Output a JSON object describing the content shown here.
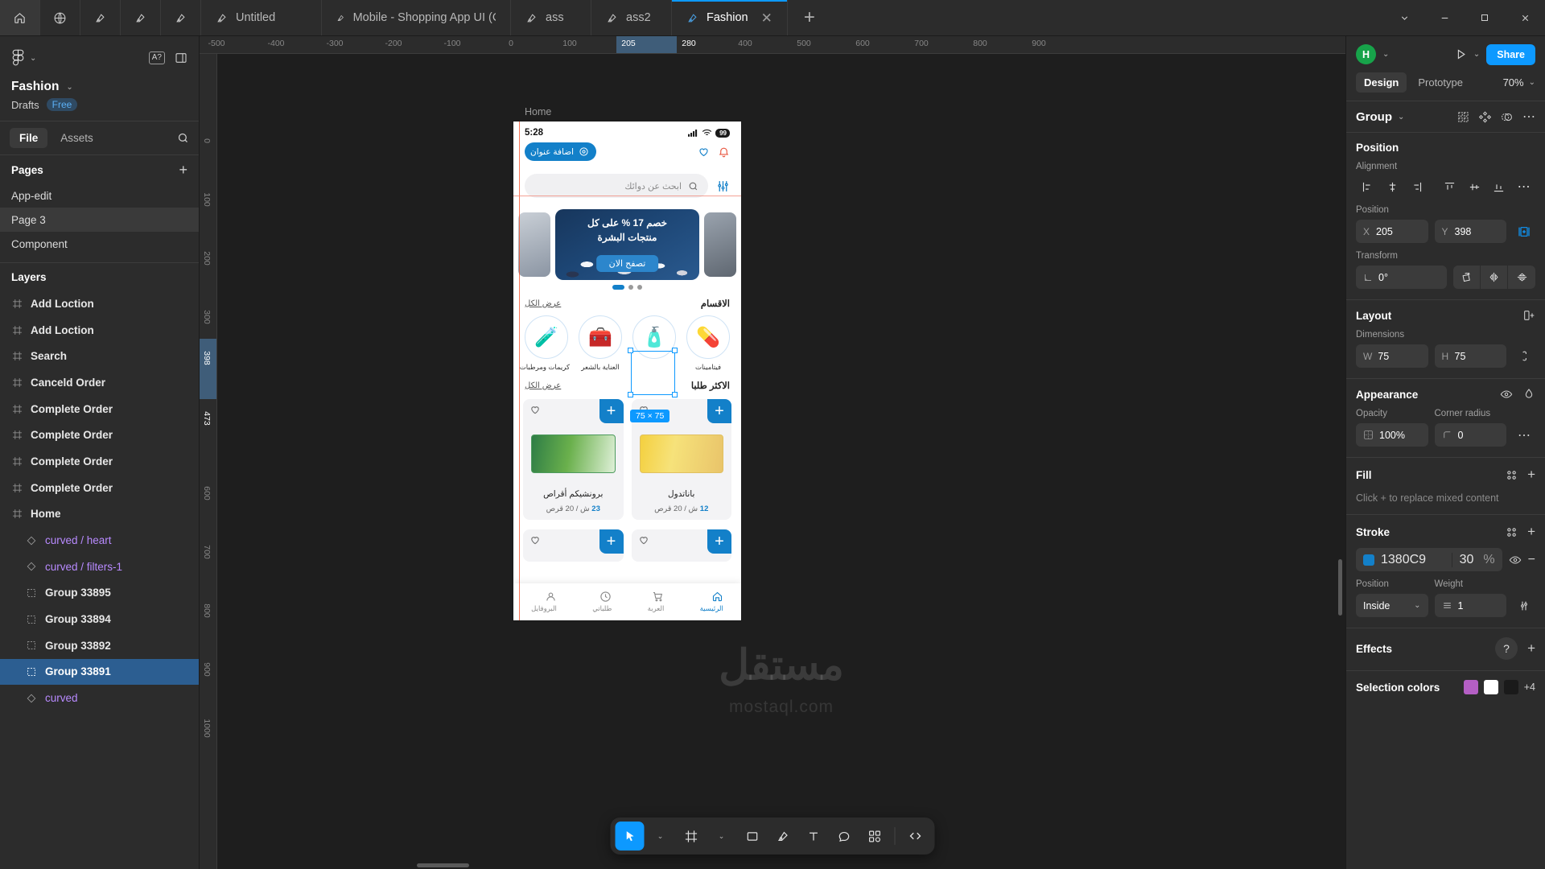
{
  "tabbar": {
    "left_icons": [
      "home-icon",
      "globe-icon",
      "file-icon",
      "file-icon",
      "file-icon"
    ],
    "tabs": [
      {
        "label": "Untitled",
        "icon": "figma-file-icon",
        "active": false,
        "closable": false
      },
      {
        "label": "Mobile - Shopping App UI (Community)",
        "icon": "figma-file-icon",
        "active": false,
        "closable": false
      },
      {
        "label": "ass",
        "icon": "figma-file-icon",
        "active": false,
        "closable": false
      },
      {
        "label": "ass2",
        "icon": "figma-file-icon",
        "active": false,
        "closable": false
      },
      {
        "label": "Fashion",
        "icon": "figma-file-icon",
        "active": true,
        "closable": true
      }
    ],
    "new_tab_label": "+",
    "window_controls": [
      "chevron-down-icon",
      "minimize-icon",
      "maximize-icon",
      "close-icon"
    ]
  },
  "left_panel": {
    "menu_icon": "figma-logo-icon",
    "a11y_badge": "A?",
    "panel_toggle_icon": "panel-layout-icon",
    "file_name": "Fashion",
    "location": "Drafts",
    "plan_badge": "Free",
    "tabs": [
      {
        "label": "File",
        "active": true
      },
      {
        "label": "Assets",
        "active": false
      }
    ],
    "search_icon": "search-icon",
    "pages_title": "Pages",
    "pages_add_label": "+",
    "pages": [
      {
        "label": "App-edit",
        "selected": false
      },
      {
        "label": "Page 3",
        "selected": true
      },
      {
        "label": "Component",
        "selected": false
      }
    ],
    "layers_title": "Layers",
    "layers": [
      {
        "label": "Add Loction",
        "icon": "frame-icon",
        "type": "frame",
        "depth": 0,
        "selected": false
      },
      {
        "label": "Add Loction",
        "icon": "frame-icon",
        "type": "frame",
        "depth": 0,
        "selected": false
      },
      {
        "label": "Search",
        "icon": "frame-icon",
        "type": "frame",
        "depth": 0,
        "selected": false
      },
      {
        "label": "Canceld Order",
        "icon": "frame-icon",
        "type": "frame",
        "depth": 0,
        "selected": false
      },
      {
        "label": "Complete Order",
        "icon": "frame-icon",
        "type": "frame",
        "depth": 0,
        "selected": false
      },
      {
        "label": "Complete Order",
        "icon": "frame-icon",
        "type": "frame",
        "depth": 0,
        "selected": false
      },
      {
        "label": "Complete Order",
        "icon": "frame-icon",
        "type": "frame",
        "depth": 0,
        "selected": false
      },
      {
        "label": "Complete Order",
        "icon": "frame-icon",
        "type": "frame",
        "depth": 0,
        "selected": false
      },
      {
        "label": "Home",
        "icon": "frame-icon",
        "type": "frame",
        "depth": 0,
        "selected": false
      },
      {
        "label": "curved / heart",
        "icon": "component-icon",
        "type": "component",
        "depth": 1,
        "selected": false
      },
      {
        "label": "curved / filters-1",
        "icon": "component-icon",
        "type": "component",
        "depth": 1,
        "selected": false
      },
      {
        "label": "Group 33895",
        "icon": "group-icon",
        "type": "group",
        "depth": 1,
        "selected": false
      },
      {
        "label": "Group 33894",
        "icon": "group-icon",
        "type": "group",
        "depth": 1,
        "selected": false
      },
      {
        "label": "Group 33892",
        "icon": "group-icon",
        "type": "group",
        "depth": 1,
        "selected": false
      },
      {
        "label": "Group 33891",
        "icon": "group-icon",
        "type": "group",
        "depth": 1,
        "selected": true
      },
      {
        "label": "curved",
        "icon": "component-icon",
        "type": "component",
        "depth": 1,
        "selected": false
      }
    ]
  },
  "canvas": {
    "ruler_h_ticks": [
      "-500",
      "-400",
      "-300",
      "-200",
      "-100",
      "0",
      "100",
      "205",
      "280",
      "400",
      "500",
      "600",
      "700",
      "800",
      "900"
    ],
    "ruler_h_selection": {
      "start_label": "205",
      "end_label": "280"
    },
    "ruler_v_ticks": [
      "0",
      "100",
      "200",
      "300",
      "398",
      "473",
      "600",
      "700",
      "800",
      "900",
      "1000"
    ],
    "ruler_v_selection": {
      "start_label": "398",
      "end_label": "473"
    },
    "frame_label": "Home",
    "selection_size_tag": "75 × 75",
    "watermark": "مستقل",
    "watermark_sub": "mostaql.com"
  },
  "phone": {
    "status_time": "5:28",
    "status_icons": [
      "signal-icon",
      "wifi-icon"
    ],
    "battery": "99",
    "address_button": "اضافة عنوان",
    "address_icon": "location-pin-icon",
    "top_icons": [
      "heart-icon",
      "notification-bell-icon"
    ],
    "filter_icon": "filters-icon",
    "search_placeholder": "ابحث عن دوائك",
    "search_icon": "search-icon",
    "banner": {
      "title_line1": "خصم 17 % على كل",
      "title_line2": "منتجات البشرة",
      "cta": "تصفح الان",
      "dots": 3,
      "active_dot": 0
    },
    "sections": [
      {
        "title": "الاقسام",
        "see_all": "عرض الكل"
      },
      {
        "title": "الاكثر طلبا",
        "see_all": "عرض الكل"
      }
    ],
    "categories": [
      {
        "label": "فيتامينات",
        "icon": "vitamins-icon"
      },
      {
        "label": "",
        "icon": "cosmetics-icon",
        "selected": true
      },
      {
        "label": "العناية بالشعر",
        "icon": "haircare-icon"
      },
      {
        "label": "كريمات ومرطبات",
        "icon": "creams-icon"
      }
    ],
    "products": [
      {
        "name": "باناتدول",
        "price_value": "12",
        "price_unit": "ش",
        "price_qty": "/ 20 قرص",
        "add_label": "+",
        "fav_icon": "heart-outline-icon"
      },
      {
        "name": "برونشيكم أقراص",
        "price_value": "23",
        "price_unit": "ش",
        "price_qty": "/ 20 قرص",
        "add_label": "+",
        "fav_icon": "heart-outline-icon"
      }
    ],
    "bottom_nav": [
      {
        "label": "الرئيسية",
        "icon": "home-icon",
        "active": true
      },
      {
        "label": "العربة",
        "icon": "cart-icon",
        "active": false
      },
      {
        "label": "طلباتي",
        "icon": "orders-icon",
        "active": false
      },
      {
        "label": "البروفايل",
        "icon": "profile-icon",
        "active": false
      }
    ]
  },
  "toolbar": {
    "tools": [
      {
        "name": "move-tool",
        "icon": "cursor-icon",
        "active": true,
        "has_chevron": true
      },
      {
        "name": "frame-tool",
        "icon": "frame-icon",
        "active": false,
        "has_chevron": true
      },
      {
        "name": "shape-tool",
        "icon": "rectangle-icon",
        "active": false,
        "has_chevron": false
      },
      {
        "name": "pen-tool",
        "icon": "pen-icon",
        "active": false,
        "has_chevron": false
      },
      {
        "name": "text-tool",
        "icon": "text-icon",
        "active": false,
        "has_chevron": false
      },
      {
        "name": "comment-tool",
        "icon": "comment-icon",
        "active": false,
        "has_chevron": false
      },
      {
        "name": "resources-tool",
        "icon": "components-icon",
        "active": false,
        "has_chevron": false
      },
      {
        "name": "dev-mode-tool",
        "icon": "code-icon",
        "active": false,
        "has_chevron": false
      }
    ]
  },
  "right_panel": {
    "avatar_initial": "H",
    "present_icon": "play-icon",
    "share_label": "Share",
    "tabs": [
      {
        "label": "Design",
        "active": true
      },
      {
        "label": "Prototype",
        "active": false
      }
    ],
    "zoom_level": "70%",
    "selection_type": "Group",
    "selection_icons": [
      "component-create-icon",
      "variant-icon",
      "mask-icon",
      "more-icon"
    ],
    "position": {
      "title": "Position",
      "alignment_label": "Alignment",
      "align_buttons": [
        "align-left-icon",
        "align-h-center-icon",
        "align-right-icon",
        "align-top-icon",
        "align-v-center-icon",
        "align-bottom-icon",
        "more-icon"
      ],
      "position_label": "Position",
      "x_key": "X",
      "x_value": "205",
      "y_key": "Y",
      "y_value": "398",
      "absolute_icon": "absolute-position-icon",
      "transform_label": "Transform",
      "rotation_value": "0°",
      "rotation_icon": "angle-icon",
      "transform_buttons": [
        "rotate-icon",
        "flip-horizontal-icon",
        "flip-vertical-icon"
      ]
    },
    "layout": {
      "title": "Layout",
      "add_icon": "add-auto-layout-icon",
      "dimensions_label": "Dimensions",
      "w_key": "W",
      "w_value": "75",
      "h_key": "H",
      "h_value": "75",
      "ratio_icon": "lock-ratio-icon"
    },
    "appearance": {
      "title": "Appearance",
      "visibility_icon": "eye-icon",
      "blend_icon": "blend-mode-icon",
      "opacity_label": "Opacity",
      "opacity_value": "100%",
      "opacity_icon": "opacity-icon",
      "corner_label": "Corner radius",
      "corner_value": "0",
      "corner_icon": "corner-radius-icon",
      "more_icon": "more-icon"
    },
    "fill": {
      "title": "Fill",
      "styles_icon": "styles-icon",
      "add_icon": "+",
      "empty_note": "Click + to replace mixed content"
    },
    "stroke": {
      "title": "Stroke",
      "styles_icon": "styles-icon",
      "add_icon": "+",
      "color_hex": "1380C9",
      "opacity_value": "30",
      "opacity_unit": "%",
      "visibility_icon": "eye-icon",
      "remove_icon": "−",
      "position_label": "Position",
      "position_value": "Inside",
      "weight_label": "Weight",
      "weight_value": "1",
      "weight_icon": "stroke-weight-icon",
      "advanced_icon": "advanced-stroke-icon"
    },
    "effects": {
      "title": "Effects",
      "help_icon": "?",
      "add_icon": "+"
    },
    "selection_colors": {
      "title": "Selection colors",
      "swatches": [
        "#b45fc4",
        "#ffffff",
        "#1a1a1a"
      ],
      "more_count": "+4"
    }
  },
  "colors": {
    "accent": "#0d99ff",
    "app_blue": "#1380c9",
    "panel_bg": "#2c2c2c",
    "canvas_bg": "#1e1e1e",
    "selected_row": "#2c5e91",
    "component_purple": "#b88aff"
  }
}
